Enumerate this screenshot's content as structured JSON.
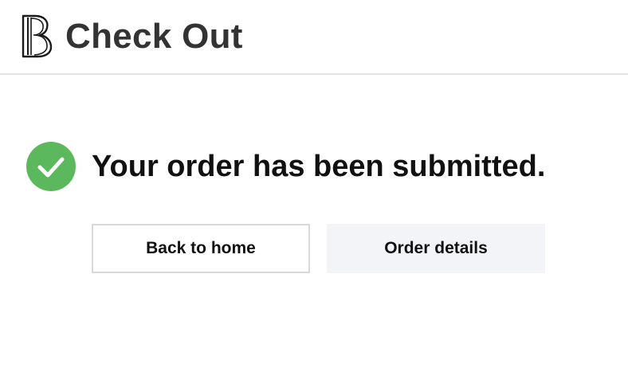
{
  "header": {
    "logo_icon": "brand-logo-b-icon",
    "title": "Check Out"
  },
  "confirmation": {
    "icon": "check-circle-icon",
    "icon_color": "#5cb85c",
    "message": "Your order has been submitted."
  },
  "actions": {
    "back_to_home_label": "Back to home",
    "order_details_label": "Order details"
  }
}
